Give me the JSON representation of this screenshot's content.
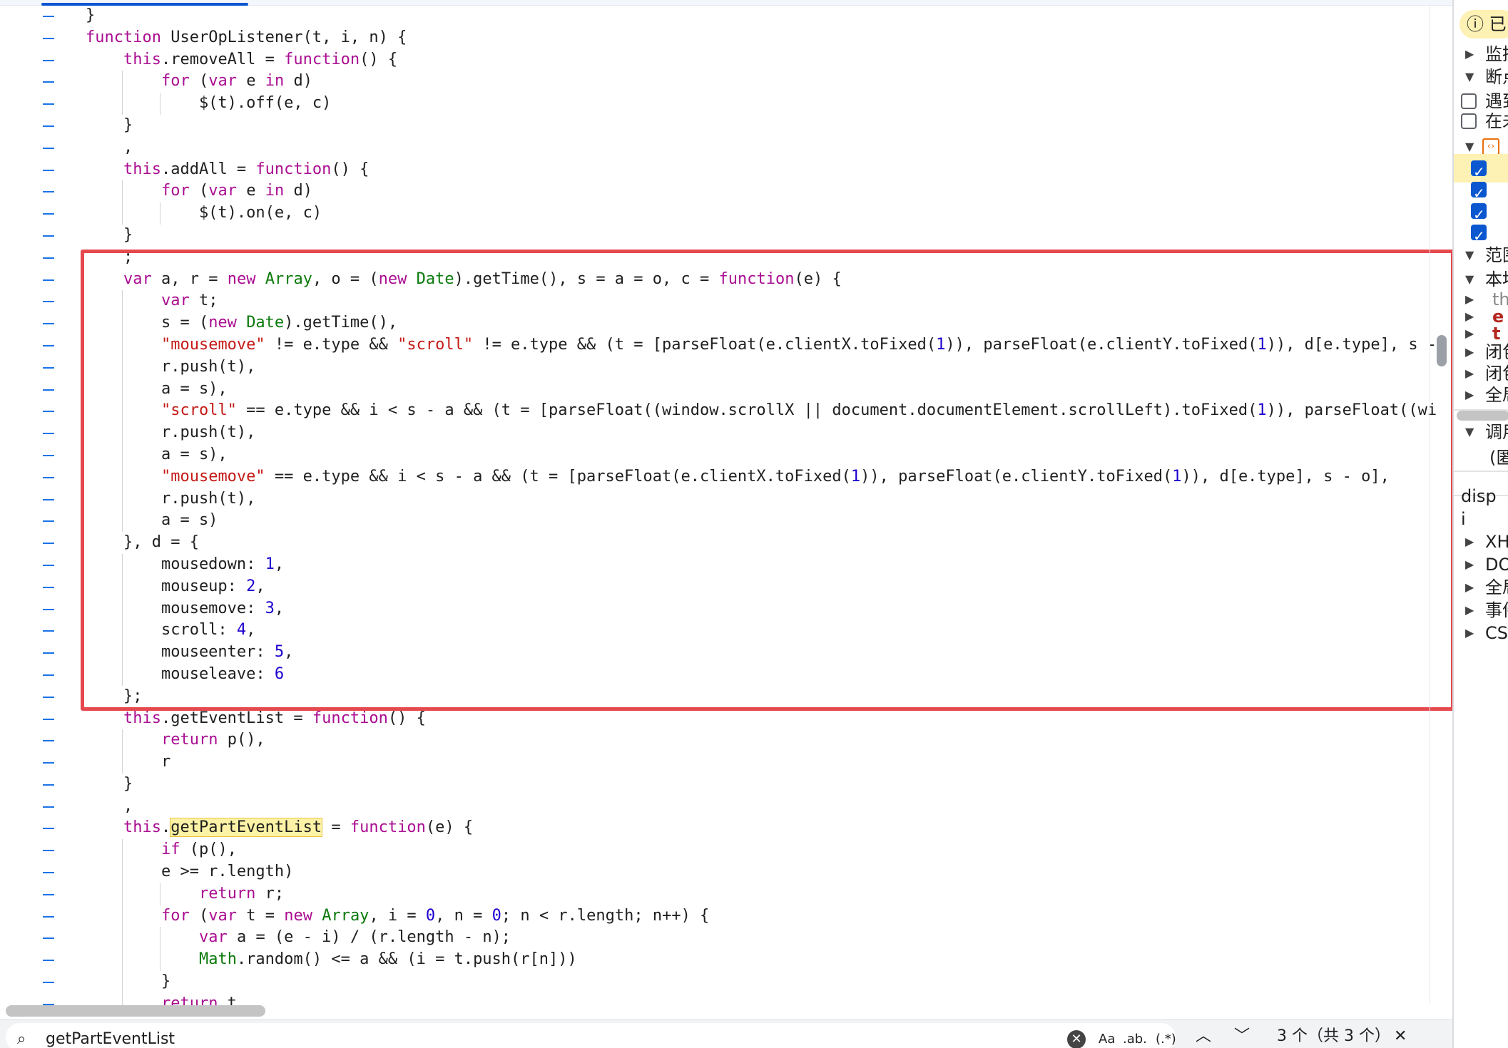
{
  "code": {
    "lines": [
      "}",
      "function UserOpListener(t, i, n) {",
      "    this.removeAll = function() {",
      "        for (var e in d)",
      "            $(t).off(e, c)",
      "    }",
      "    ,",
      "    this.addAll = function() {",
      "        for (var e in d)",
      "            $(t).on(e, c)",
      "    }",
      "    ;",
      "    var a, r = new Array, o = (new Date).getTime(), s = a = o, c = function(e) {",
      "        var t;",
      "        s = (new Date).getTime(),",
      "        \"mousemove\" != e.type && \"scroll\" != e.type && (t = [parseFloat(e.clientX.toFixed(1)), parseFloat(e.clientY.toFixed(1)), d[e.type], s -",
      "        r.push(t),",
      "        a = s),",
      "        \"scroll\" == e.type && i < s - a && (t = [parseFloat((window.scrollX || document.documentElement.scrollLeft).toFixed(1)), parseFloat((wi",
      "        r.push(t),",
      "        a = s),",
      "        \"mousemove\" == e.type && i < s - a && (t = [parseFloat(e.clientX.toFixed(1)), parseFloat(e.clientY.toFixed(1)), d[e.type], s - o],",
      "        r.push(t),",
      "        a = s)",
      "    }, d = {",
      "        mousedown: 1,",
      "        mouseup: 2,",
      "        mousemove: 3,",
      "        scroll: 4,",
      "        mouseenter: 5,",
      "        mouseleave: 6",
      "    };",
      "    this.getEventList = function() {",
      "        return p(),",
      "        r",
      "    }",
      "    ,",
      "    this.getPartEventList = function(e) {",
      "        if (p(),",
      "        e >= r.length)",
      "            return r;",
      "        for (var t = new Array, i = 0, n = 0; n < r.length; n++) {",
      "            var a = (e - i) / (r.length - n);",
      "            Math.random() <= a && (i = t.push(r[n]))",
      "        }",
      "        return t"
    ],
    "highlight_word": "getPartEventList"
  },
  "side_panel": {
    "info_badge": "ⓘ 已",
    "sections": [
      {
        "label": "监控",
        "tri": "▶"
      },
      {
        "label": "断点",
        "tri": "▼"
      },
      {
        "label": "遇到",
        "check": "off"
      },
      {
        "label": "在未",
        "check": "off"
      },
      {
        "label": "",
        "tri": "▼",
        "file_icon": "‹›"
      },
      {
        "label": "",
        "check": "on"
      },
      {
        "label": "",
        "check": "on"
      },
      {
        "label": "",
        "check": "on"
      },
      {
        "label": "",
        "check": "on"
      },
      {
        "label": "范围",
        "tri": "▼"
      },
      {
        "label": "本地",
        "tri": "▼"
      },
      {
        "label": "th",
        "tri": "▶"
      },
      {
        "label": "e",
        "tri": "▶"
      },
      {
        "label": "t",
        "tri": "▶"
      },
      {
        "label": "闭包",
        "tri": "▶"
      },
      {
        "label": "闭包",
        "tri": "▶"
      },
      {
        "label": "全局",
        "tri": "▶"
      },
      {
        "label": "调用",
        "tri": "▼"
      },
      {
        "label": "(匿",
        "tri": ""
      },
      {
        "label": "disp",
        "tri": ""
      },
      {
        "label": "i",
        "tri": ""
      },
      {
        "label": "XH",
        "tri": "▶"
      },
      {
        "label": "DO",
        "tri": "▶"
      },
      {
        "label": "全局",
        "tri": "▶"
      },
      {
        "label": "事件",
        "tri": "▶"
      },
      {
        "label": "CS",
        "tri": "▶"
      }
    ]
  },
  "search": {
    "query": "getPartEventList",
    "match_case": "Aa",
    "whole_word": ".ab.",
    "regex": "(.*)",
    "result_count": "3 个（共 3 个）"
  },
  "colors": {
    "keyword": "#aa0d91",
    "string": "#c41a16",
    "number": "#1c00cf",
    "highlight_box": "#e5484d"
  }
}
